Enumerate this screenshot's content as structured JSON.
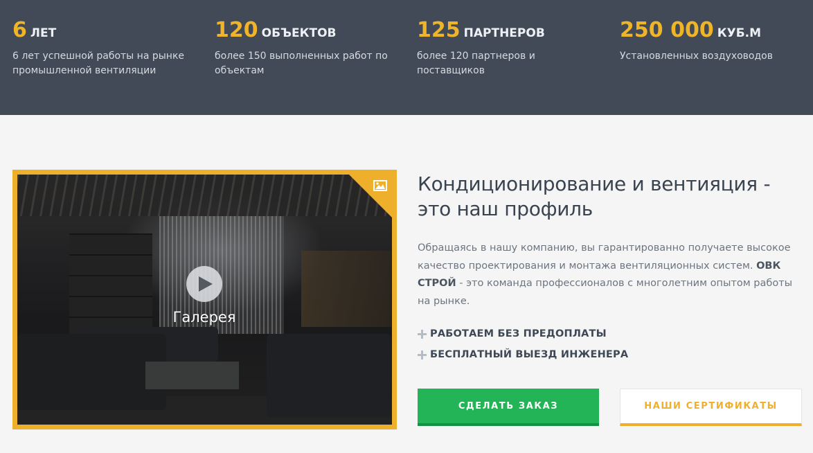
{
  "stats": [
    {
      "number": "6",
      "unit": "ЛЕТ",
      "desc": "6 лет успешной работы на рынке промышленной вентиляции"
    },
    {
      "number": "120",
      "unit": "ОБЪЕКТОВ",
      "desc": "более 150 выполненных работ по объектам"
    },
    {
      "number": "125",
      "unit": "ПАРТНЕРОВ",
      "desc": "более 120 партнеров и поставщиков"
    },
    {
      "number": "250 000",
      "unit": "КУБ.М",
      "desc": "Установленных воздуховодов"
    }
  ],
  "gallery": {
    "label": "Галерея",
    "icons": {
      "corner": "image-icon",
      "play": "play-icon"
    }
  },
  "info": {
    "heading": "Кондиционирование и вентияция - это наш профиль",
    "para_before": "Обращаясь в нашу компанию, вы гарантированно получаете высокое качество проектирования и монтажа вентиляционных систем. ",
    "para_bold": "ОВК СТРОЙ",
    "para_after": " - это команда профессионалов с многолетним опытом работы на рынке.",
    "features": [
      "РАБОТАЕМ БЕЗ ПРЕДОПЛАТЫ",
      "БЕСПЛАТНЫЙ ВЫЕЗД ИНЖЕНЕРА"
    ]
  },
  "buttons": {
    "order": "СДЕЛАТЬ ЗАКАЗ",
    "certificates": "НАШИ СЕРТИФИКАТЫ"
  },
  "colors": {
    "stats_bg": "#414a56",
    "accent": "#eeb02b",
    "green": "#22b456",
    "page_bg": "#f5f5f5"
  }
}
